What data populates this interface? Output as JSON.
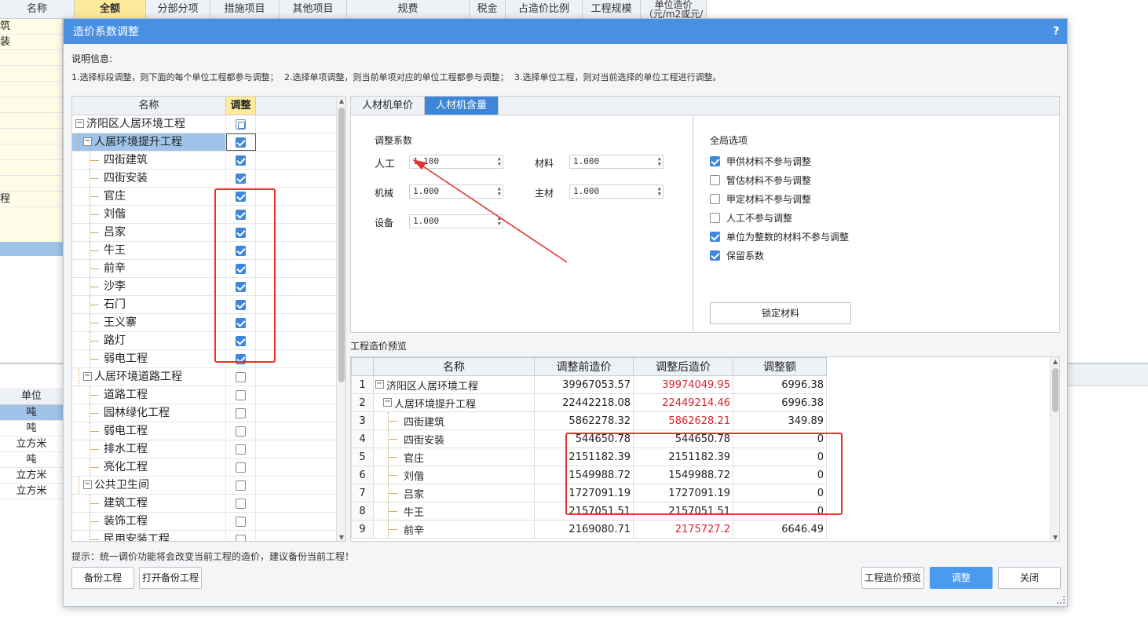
{
  "background": {
    "header_name": "名称",
    "header_cols": [
      "全额",
      "分部分项",
      "措施项目",
      "其他项目",
      "规费",
      "税金",
      "占造价比例",
      "工程规模",
      "单位造价"
    ],
    "header_sub": "（元/m2或元/",
    "name_fragments": [
      "筑",
      "装",
      "",
      "",
      "",
      "",
      "",
      "",
      "",
      "",
      "",
      "程",
      "",
      ""
    ],
    "units_head": "单位",
    "units": [
      "吨",
      "吨",
      "立方米",
      "吨",
      "立方米",
      "立方米"
    ]
  },
  "dialog": {
    "title": "造价系数调整",
    "help": "?",
    "info_label": "说明信息:",
    "info_text": "1.选择标段调整，则下面的每个单位工程都参与调整；  2.选择单项调整，则当前单项对应的单位工程都参与调整；  3.选择单位工程，则对当前选择的单位工程进行调整。",
    "tree": {
      "col_name": "名称",
      "col_adjust": "调整",
      "rows": [
        {
          "label": "济阳区人居环境工程",
          "level": 0,
          "expander": "−",
          "state": "partial",
          "sel": false
        },
        {
          "label": "人居环境提升工程",
          "level": 1,
          "expander": "−",
          "state": "on",
          "sel": true
        },
        {
          "label": "四街建筑",
          "level": 2,
          "state": "on"
        },
        {
          "label": "四街安装",
          "level": 2,
          "state": "on"
        },
        {
          "label": "官庄",
          "level": 2,
          "state": "on"
        },
        {
          "label": "刘偕",
          "level": 2,
          "state": "on"
        },
        {
          "label": "吕家",
          "level": 2,
          "state": "on"
        },
        {
          "label": "牛王",
          "level": 2,
          "state": "on"
        },
        {
          "label": "前辛",
          "level": 2,
          "state": "on"
        },
        {
          "label": "沙李",
          "level": 2,
          "state": "on"
        },
        {
          "label": "石门",
          "level": 2,
          "state": "on"
        },
        {
          "label": "王义寨",
          "level": 2,
          "state": "on"
        },
        {
          "label": "路灯",
          "level": 2,
          "state": "on"
        },
        {
          "label": "弱电工程",
          "level": 2,
          "state": "on"
        },
        {
          "label": "人居环境道路工程",
          "level": 1,
          "expander": "−",
          "state": "off"
        },
        {
          "label": "道路工程",
          "level": 2,
          "state": "off"
        },
        {
          "label": "园林绿化工程",
          "level": 2,
          "state": "off"
        },
        {
          "label": "弱电工程",
          "level": 2,
          "state": "off"
        },
        {
          "label": "排水工程",
          "level": 2,
          "state": "off"
        },
        {
          "label": "亮化工程",
          "level": 2,
          "state": "off"
        },
        {
          "label": "公共卫生间",
          "level": 1,
          "expander": "−",
          "state": "off"
        },
        {
          "label": "建筑工程",
          "level": 2,
          "state": "off"
        },
        {
          "label": "装饰工程",
          "level": 2,
          "state": "off"
        },
        {
          "label": "民用安装工程",
          "level": 2,
          "state": "off"
        }
      ]
    },
    "tabs": [
      "人材机单价",
      "人材机含量"
    ],
    "active_tab": 1,
    "coef": {
      "title": "调整系数",
      "labor_label": "人工",
      "labor_value": "1.100",
      "material_label": "材料",
      "material_value": "1.000",
      "machine_label": "机械",
      "machine_value": "1.000",
      "main_label": "主材",
      "main_value": "1.000",
      "equip_label": "设备",
      "equip_value": "1.000"
    },
    "global": {
      "title": "全局选项",
      "options": [
        {
          "label": "甲供材料不参与调整",
          "checked": true
        },
        {
          "label": "暂估材料不参与调整",
          "checked": false
        },
        {
          "label": "甲定材料不参与调整",
          "checked": false
        },
        {
          "label": "人工不参与调整",
          "checked": false
        },
        {
          "label": "单位为整数的材料不参与调整",
          "checked": true
        },
        {
          "label": "保留系数",
          "checked": true
        }
      ],
      "lock_button": "锁定材料"
    },
    "preview": {
      "label": "工程造价预览",
      "columns": [
        "名称",
        "调整前造价",
        "调整后造价",
        "调整额"
      ],
      "rows": [
        {
          "idx": "1",
          "name": "济阳区人居环境工程",
          "level": 0,
          "before": "39967053.57",
          "after": "39974049.95",
          "diff": "6996.38",
          "changed": true
        },
        {
          "idx": "2",
          "name": "人居环境提升工程",
          "level": 1,
          "before": "22442218.08",
          "after": "22449214.46",
          "diff": "6996.38",
          "changed": true
        },
        {
          "idx": "3",
          "name": "四街建筑",
          "level": 2,
          "before": "5862278.32",
          "after": "5862628.21",
          "diff": "349.89",
          "changed": true
        },
        {
          "idx": "4",
          "name": "四街安装",
          "level": 2,
          "before": "544650.78",
          "after": "544650.78",
          "diff": "0",
          "changed": false
        },
        {
          "idx": "5",
          "name": "官庄",
          "level": 2,
          "before": "2151182.39",
          "after": "2151182.39",
          "diff": "0",
          "changed": false
        },
        {
          "idx": "6",
          "name": "刘偕",
          "level": 2,
          "before": "1549988.72",
          "after": "1549988.72",
          "diff": "0",
          "changed": false
        },
        {
          "idx": "7",
          "name": "吕家",
          "level": 2,
          "before": "1727091.19",
          "after": "1727091.19",
          "diff": "0",
          "changed": false
        },
        {
          "idx": "8",
          "name": "牛王",
          "level": 2,
          "before": "2157051.51",
          "after": "2157051.51",
          "diff": "0",
          "changed": false
        },
        {
          "idx": "9",
          "name": "前辛",
          "level": 2,
          "before": "2169080.71",
          "after": "2175727.2",
          "diff": "6646.49",
          "changed": true
        }
      ]
    },
    "tip": "提示：统一调价功能将会改变当前工程的造价，建议备份当前工程！",
    "buttons": {
      "backup": "备份工程",
      "open_backup": "打开备份工程",
      "preview": "工程造价预览",
      "adjust": "调整",
      "close": "关闭"
    },
    "colors": {
      "accent": "#4a90e2",
      "checked": "#3e86d8",
      "changed_value": "#d9232d",
      "annotation": "#e8322d"
    }
  }
}
